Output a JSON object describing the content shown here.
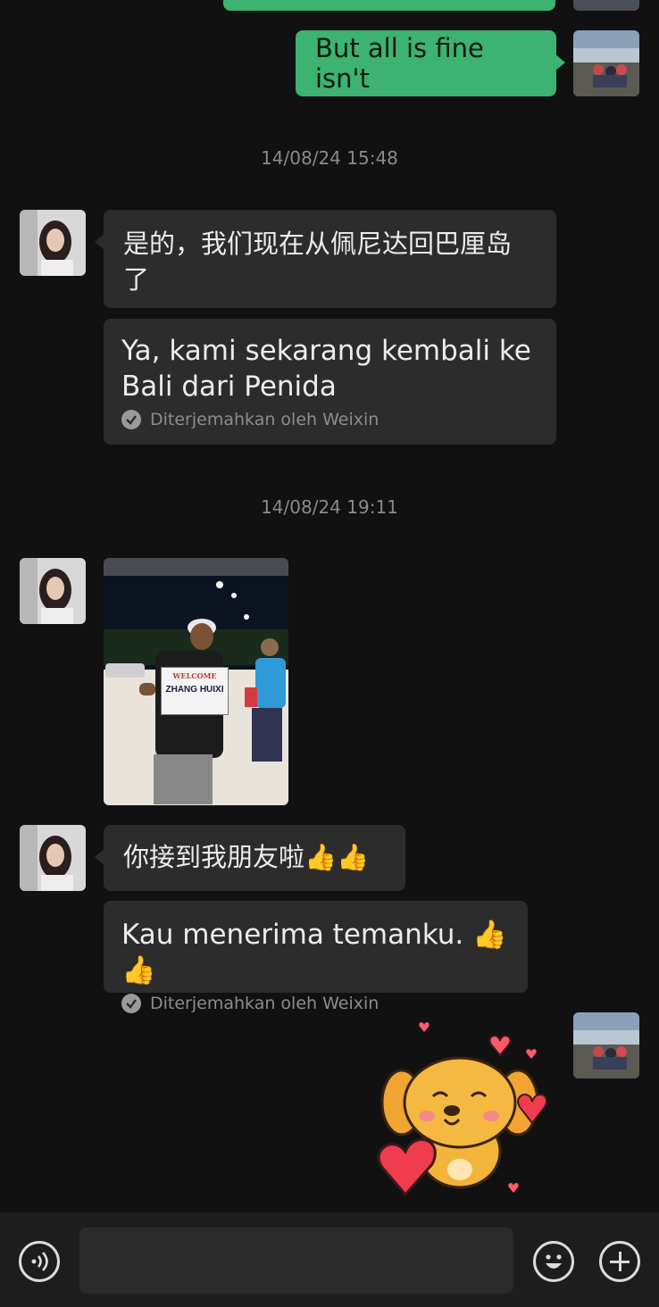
{
  "messages": {
    "outgoing_1": "But all is fine isn't",
    "timestamp_1": "14/08/24 15:48",
    "incoming_1": "是的，我们现在从佩尼达回巴厘岛了",
    "incoming_1_translation": "Ya, kami sekarang kembali ke Bali dari Penida",
    "translated_by": "Diterjemahkan oleh Weixin",
    "timestamp_2": "14/08/24 19:11",
    "photo_sign_top": "WELCOME",
    "photo_sign_name": "ZHANG HUIXI",
    "incoming_2": "你接到我朋友啦👍👍",
    "incoming_2_translation": "Kau menerima temanku. 👍👍"
  },
  "icons": {
    "voice": "voice-icon",
    "emoji": "emoji-icon",
    "plus": "plus-icon",
    "check": "check-icon"
  },
  "colors": {
    "outgoing_bubble": "#3cb371",
    "incoming_bubble": "#2c2c2c",
    "background": "#111111"
  }
}
